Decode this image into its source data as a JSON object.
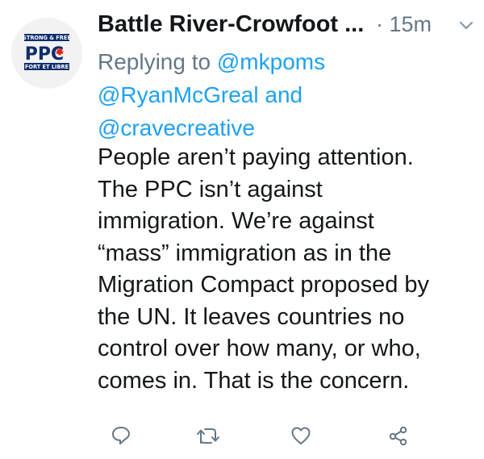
{
  "tweet": {
    "avatar": {
      "top_text": "STRONG & FREE",
      "logo_text": "PPC",
      "bottom_text": "FORT ET LIBRE",
      "colors": {
        "navy": "#0b2d6b",
        "red": "#e2231a"
      }
    },
    "display_name": "Battle River-Crowfoot ...",
    "time": "· 15m",
    "reply": {
      "prefix": "Replying to ",
      "mention1": "@mkpoms",
      "mention2": "@RyanMcGreal",
      "connector": " and",
      "mention3": "@cravecreative"
    },
    "text": "People aren’t paying attention.\nThe PPC isn’t against\nimmigration. We’re against\n“mass” immigration as in the\nMigration Compact proposed by\nthe UN. It leaves countries no\ncontrol over how many, or who,\ncomes in. That is the concern."
  },
  "actions": {
    "reply_icon": "reply-icon",
    "retweet_icon": "retweet-icon",
    "like_icon": "heart-icon",
    "share_icon": "share-icon",
    "color": "#657786"
  }
}
